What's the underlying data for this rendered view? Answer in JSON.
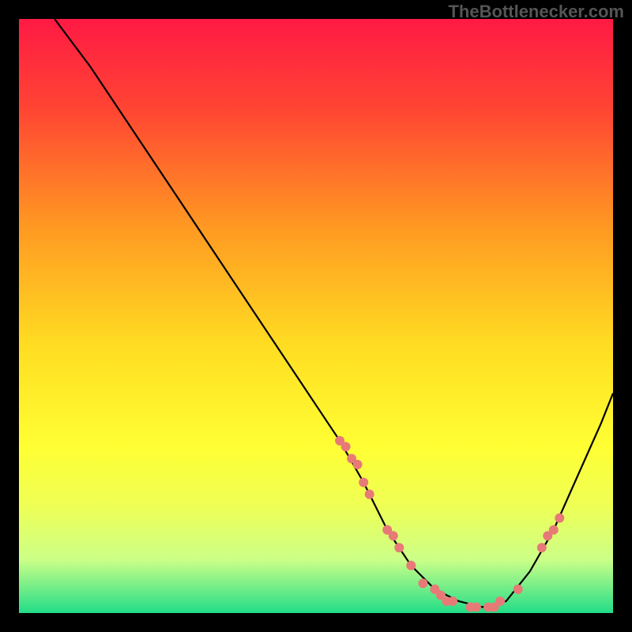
{
  "watermark": "TheBottlenecker.com",
  "chart_data": {
    "type": "line",
    "title": "",
    "xlabel": "",
    "ylabel": "",
    "xlim": [
      0,
      100
    ],
    "ylim": [
      0,
      100
    ],
    "background_gradient": {
      "stops": [
        {
          "offset": 0.0,
          "color": "#ff1a44"
        },
        {
          "offset": 0.15,
          "color": "#ff4433"
        },
        {
          "offset": 0.35,
          "color": "#ff9922"
        },
        {
          "offset": 0.55,
          "color": "#ffdd22"
        },
        {
          "offset": 0.72,
          "color": "#ffff33"
        },
        {
          "offset": 0.82,
          "color": "#eeff55"
        },
        {
          "offset": 0.91,
          "color": "#ccff88"
        },
        {
          "offset": 1.0,
          "color": "#22dd88"
        }
      ]
    },
    "curve": {
      "x": [
        6,
        12,
        20,
        28,
        36,
        44,
        50,
        54,
        58,
        62,
        66,
        70,
        74,
        78,
        82,
        86,
        90,
        94,
        98,
        100
      ],
      "y": [
        100,
        92,
        80,
        68,
        56,
        44,
        35,
        29,
        22,
        14,
        8,
        4,
        2,
        1,
        2,
        7,
        14,
        23,
        32,
        37
      ]
    },
    "dots": {
      "x": [
        54,
        55,
        56,
        57,
        58,
        59,
        62,
        63,
        64,
        66,
        68,
        70,
        71,
        72,
        73,
        76,
        77,
        79,
        80,
        81,
        84,
        88,
        89,
        90,
        91
      ],
      "y": [
        29,
        28,
        26,
        25,
        22,
        20,
        14,
        13,
        11,
        8,
        5,
        4,
        3,
        2,
        2,
        1,
        1,
        1,
        1,
        2,
        4,
        11,
        13,
        14,
        16
      ]
    }
  }
}
